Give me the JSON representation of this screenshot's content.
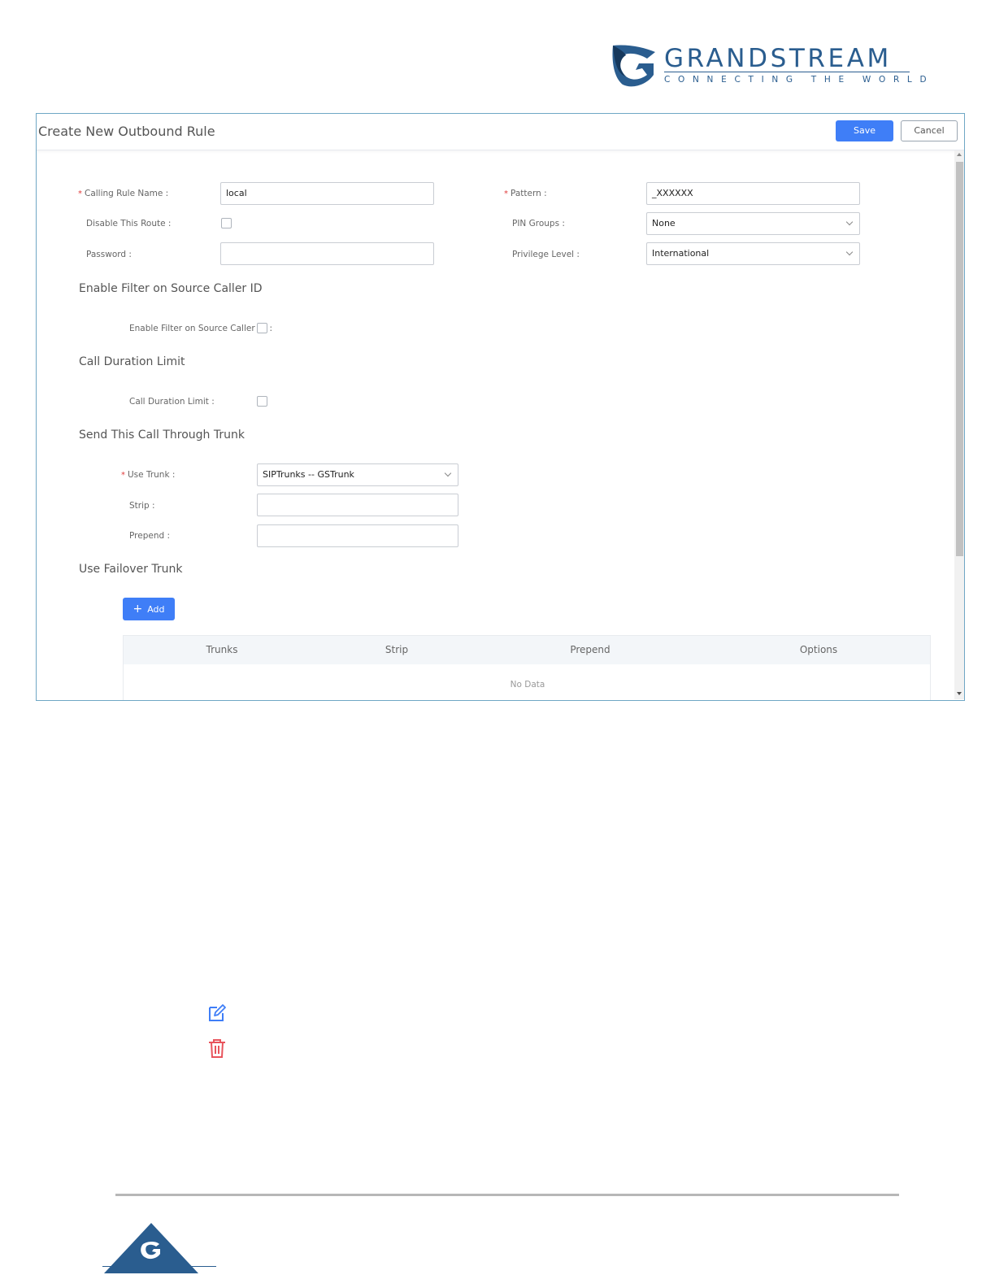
{
  "logo": {
    "wordmark": "GRANDSTREAM",
    "tagline": "CONNECTING THE WORLD",
    "color": "#2a5d8f"
  },
  "dialog": {
    "title": "Create New Outbound Rule",
    "save_label": "Save",
    "cancel_label": "Cancel",
    "accent_color": "#3f7ef7"
  },
  "form": {
    "calling_rule_name": {
      "label": "Calling Rule Name :",
      "value": "local",
      "required": true
    },
    "pattern": {
      "label": "Pattern :",
      "value": "_XXXXXX",
      "required": true
    },
    "disable_route": {
      "label": "Disable This Route :",
      "checked": false
    },
    "pin_groups": {
      "label": "PIN Groups :",
      "value": "None"
    },
    "password": {
      "label": "Password :",
      "value": ""
    },
    "privilege_level": {
      "label": "Privilege Level :",
      "value": "International"
    }
  },
  "sections": {
    "source_filter": {
      "title": "Enable Filter on Source Caller ID",
      "checkbox_label": "Enable Filter on Source Caller ID :"
    },
    "duration": {
      "title": "Call Duration Limit",
      "checkbox_label": "Call Duration Limit :"
    },
    "trunk": {
      "title": "Send This Call Through Trunk",
      "use_trunk_label": "Use Trunk :",
      "use_trunk_value": "SIPTrunks -- GSTrunk",
      "strip_label": "Strip :",
      "strip_value": "",
      "prepend_label": "Prepend :",
      "prepend_value": ""
    },
    "failover": {
      "title": "Use Failover Trunk",
      "add_label": "Add",
      "columns": [
        "Trunks",
        "Strip",
        "Prepend",
        "Options"
      ],
      "empty_text": "No Data"
    }
  },
  "icons": [
    "edit-icon",
    "trash-icon"
  ]
}
